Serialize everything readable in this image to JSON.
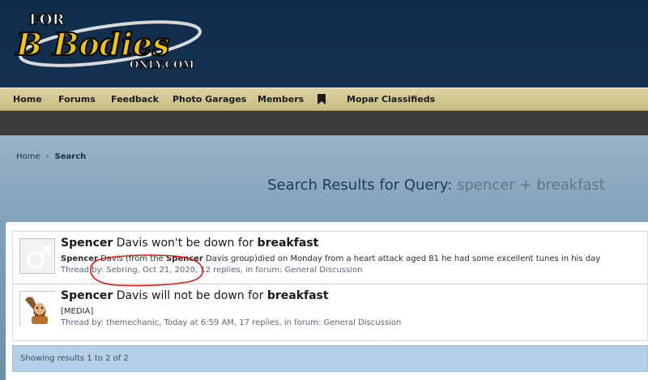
{
  "logo": {
    "line1": "FOR",
    "line2": "B Bodies",
    "line3": "ONLY.COM"
  },
  "nav": {
    "home": "Home",
    "forums": "Forums",
    "feedback": "Feedback",
    "photo_garages": "Photo Garages",
    "members": "Members",
    "mopar_classifieds": "Mopar Classifieds"
  },
  "breadcrumb": {
    "home": "Home",
    "sep": "›",
    "current": "Search"
  },
  "page": {
    "title_prefix": "Search Results for Query:",
    "query": "spencer + breakfast"
  },
  "results": [
    {
      "title_a": "Spencer",
      "title_b": " Davis won't be down for ",
      "title_c": "breakfast",
      "snippet_a": "Spencer",
      "snippet_b": " Davis (from the ",
      "snippet_c": "Spencer",
      "snippet_d": " Davis group)died on Monday from a heart attack aged 81 he had some excellent tunes in his day",
      "meta_prefix": "Thread by: ",
      "author": "Sebring",
      "meta_mid": ", Oct 21, 2020, 12 replies, in forum: ",
      "forum": "General Discussion"
    },
    {
      "title_a": "Spencer",
      "title_b": " Davis will not be down for ",
      "title_c": "breakfast",
      "snippet": "[MEDIA]",
      "meta_prefix": "Thread by: ",
      "author": "themechanic",
      "meta_mid": ", Today at 6:59 AM, 17 replies, in forum: ",
      "forum": "General Discussion"
    }
  ],
  "footer": {
    "showing": "Showing results 1 to 2 of 2"
  },
  "colors": {
    "header": "#0f2c4a",
    "nav": "#d6cc98",
    "accent_red": "#e01818",
    "footer_bar": "#b7d0e9"
  },
  "icons": {
    "bookmark": "bookmark-icon",
    "avatar1": "male-symbol-icon",
    "avatar2": "caveman-avatar-icon"
  }
}
